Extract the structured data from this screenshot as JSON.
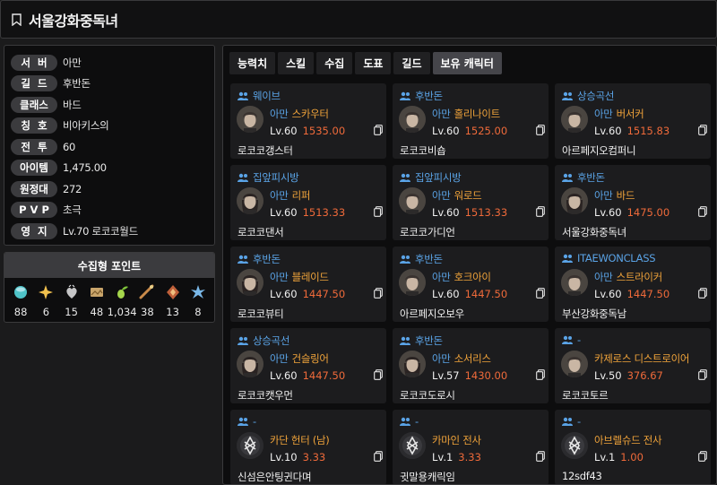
{
  "header": {
    "title": "서울강화중독녀"
  },
  "info": [
    {
      "label": "서  버",
      "value": "아만"
    },
    {
      "label": "길  드",
      "value": "후반돈"
    },
    {
      "label": "클래스",
      "value": "바드"
    },
    {
      "label": "칭  호",
      "value": "비아키스의"
    },
    {
      "label": "전  투",
      "value": "60"
    },
    {
      "label": "아이템",
      "value": "1,475.00"
    },
    {
      "label": "원정대",
      "value": "272"
    },
    {
      "label": "P V P",
      "value": "초극"
    },
    {
      "label": "영  지",
      "value": "Lv.70 로코코월드"
    }
  ],
  "collect": {
    "title": "수집형 포인트",
    "items": [
      {
        "icon": "island-heart-icon",
        "count": "88",
        "color": "#4fc3c8"
      },
      {
        "icon": "orpheus-star-icon",
        "count": "6",
        "color": "#f2c14e"
      },
      {
        "icon": "giant-heart-icon",
        "count": "15",
        "color": "#e8e8e8"
      },
      {
        "icon": "art-painting-icon",
        "count": "48",
        "color": "#c9a56b"
      },
      {
        "icon": "mokoko-seed-icon",
        "count": "1,034",
        "color": "#a5d64c"
      },
      {
        "icon": "voyage-adventure-icon",
        "count": "38",
        "color": "#c98a4a"
      },
      {
        "icon": "ignea-token-icon",
        "count": "13",
        "color": "#c0603a"
      },
      {
        "icon": "world-tree-leaf-icon",
        "count": "8",
        "color": "#7ab8e8"
      }
    ]
  },
  "tabs": [
    {
      "label": "능력치",
      "active": false
    },
    {
      "label": "스킬",
      "active": false
    },
    {
      "label": "수집",
      "active": false
    },
    {
      "label": "도표",
      "active": false
    },
    {
      "label": "길드",
      "active": false
    },
    {
      "label": "보유 캐릭터",
      "active": true
    }
  ],
  "characters": [
    {
      "guild": "웨이브",
      "server": "아만",
      "class": "스카우터",
      "level": "Lv.60",
      "ilvl": "1535.00",
      "name": "로코코갱스터",
      "portrait": "portrait-male"
    },
    {
      "guild": "후반돈",
      "server": "아만",
      "class": "홀리나이트",
      "level": "Lv.60",
      "ilvl": "1525.00",
      "name": "로코코비숍",
      "portrait": "portrait-male"
    },
    {
      "guild": "상승곡선",
      "server": "아만",
      "class": "버서커",
      "level": "Lv.60",
      "ilvl": "1515.83",
      "name": "아르페지오컴퍼니",
      "portrait": "portrait-male"
    },
    {
      "guild": "집앞피시방",
      "server": "아만",
      "class": "리퍼",
      "level": "Lv.60",
      "ilvl": "1513.33",
      "name": "로코코댄서",
      "portrait": "portrait-female"
    },
    {
      "guild": "집앞피시방",
      "server": "아만",
      "class": "워로드",
      "level": "Lv.60",
      "ilvl": "1513.33",
      "name": "로코코가디언",
      "portrait": "portrait-male"
    },
    {
      "guild": "후반돈",
      "server": "아만",
      "class": "바드",
      "level": "Lv.60",
      "ilvl": "1475.00",
      "name": "서울강화중독녀",
      "portrait": "portrait-female"
    },
    {
      "guild": "후반돈",
      "server": "아만",
      "class": "블레이드",
      "level": "Lv.60",
      "ilvl": "1447.50",
      "name": "로코코뷰티",
      "portrait": "portrait-female"
    },
    {
      "guild": "후반돈",
      "server": "아만",
      "class": "호크아이",
      "level": "Lv.60",
      "ilvl": "1447.50",
      "name": "아르페지오보우",
      "portrait": "portrait-male"
    },
    {
      "guild": "ITAEWONCLASS",
      "server": "아만",
      "class": "스트라이커",
      "level": "Lv.60",
      "ilvl": "1447.50",
      "name": "부산강화중독남",
      "portrait": "portrait-male"
    },
    {
      "guild": "상승곡선",
      "server": "아만",
      "class": "건슬링어",
      "level": "Lv.60",
      "ilvl": "1447.50",
      "name": "로코코캣우먼",
      "portrait": "portrait-female"
    },
    {
      "guild": "후반돈",
      "server": "아만",
      "class": "소서리스",
      "level": "Lv.57",
      "ilvl": "1430.00",
      "name": "로코코도로시",
      "portrait": "portrait-female"
    },
    {
      "guild": "-",
      "server": "",
      "class": "카제로스 디스트로이어",
      "level": "Lv.50",
      "ilvl": "376.67",
      "name": "로코코토르",
      "portrait": "portrait-male"
    },
    {
      "guild": "-",
      "server": "",
      "class": "카단 헌터 (남)",
      "level": "Lv.10",
      "ilvl": "3.33",
      "name": "신섬은안팅귄다며",
      "portrait": "class-emblem"
    },
    {
      "guild": "-",
      "server": "",
      "class": "카마인 전사",
      "level": "Lv.1",
      "ilvl": "3.33",
      "name": "귓말용캐릭임",
      "portrait": "class-emblem"
    },
    {
      "guild": "-",
      "server": "",
      "class": "아브렐슈드 전사",
      "level": "Lv.1",
      "ilvl": "1.00",
      "name": "12sdf43",
      "portrait": "class-emblem"
    }
  ],
  "colors": {
    "guild": "#5aa3e6",
    "server": "#5aa3e6",
    "class": "#f0a33a",
    "itemLevel": "#ef6a3a"
  }
}
